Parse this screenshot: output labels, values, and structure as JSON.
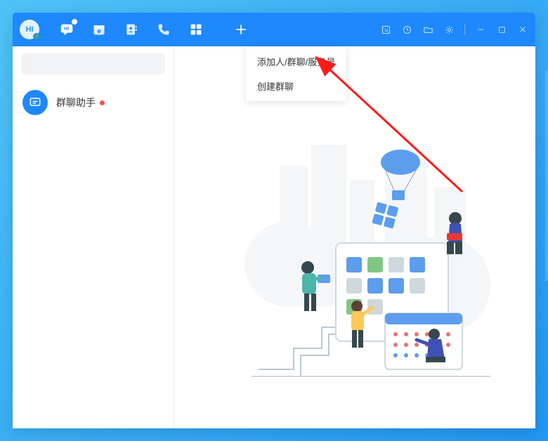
{
  "avatar": {
    "text": "HI"
  },
  "nav": {
    "chat_icon": "chat",
    "calendar_icon": "calendar",
    "contacts_icon": "contacts",
    "call_icon": "call",
    "apps_icon": "apps",
    "add_icon": "add"
  },
  "topbar": {
    "clip_icon": "screenshot",
    "history_icon": "history",
    "folder_icon": "folder",
    "settings_icon": "settings",
    "minimize_icon": "minimize",
    "maximize_icon": "maximize",
    "close_icon": "close"
  },
  "dropdown": {
    "items": [
      {
        "label": "添加人/群聊/服务号"
      },
      {
        "label": "创建群聊"
      }
    ]
  },
  "search": {
    "placeholder": ""
  },
  "chat_list": {
    "items": [
      {
        "title": "群聊助手",
        "unread": true
      }
    ]
  }
}
